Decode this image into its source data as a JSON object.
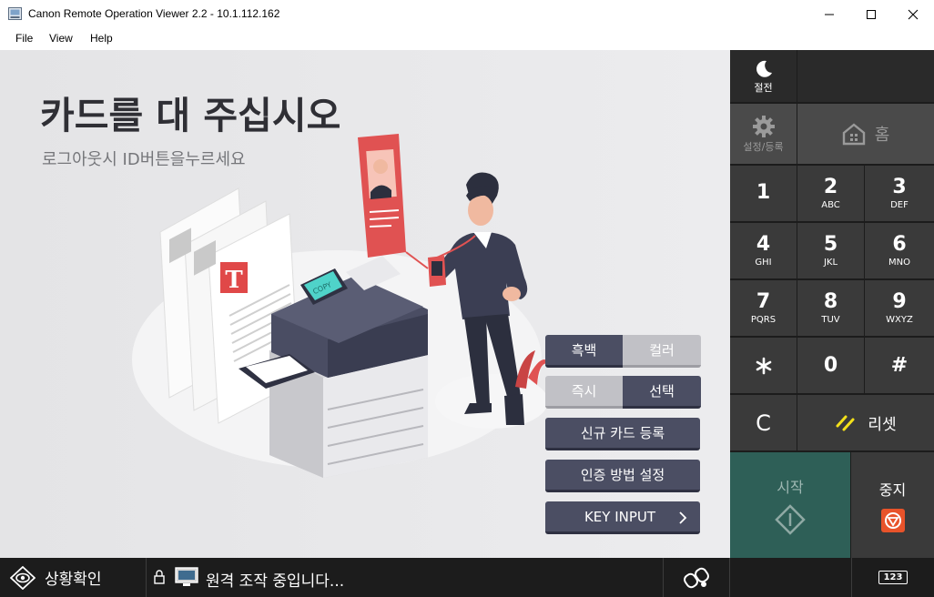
{
  "window": {
    "title": "Canon Remote Operation Viewer 2.2 - 10.1.112.162",
    "menu": [
      "File",
      "View",
      "Help"
    ]
  },
  "screen": {
    "headline": "카드를 대 주십시오",
    "subline": "로그아웃시 ID버튼을누르세요",
    "illustration": {
      "copier_display": "COPY",
      "paper_letter": "T"
    },
    "color_toggle": {
      "left": "흑백",
      "right": "컬러",
      "selected": "left"
    },
    "mode_toggle": {
      "left": "즉시",
      "right": "선택",
      "selected": "right"
    },
    "buttons": {
      "register_card": "신규 카드 등록",
      "auth_settings": "인증 방법 설정",
      "key_input": "KEY INPUT"
    }
  },
  "panel": {
    "sleep_label": "절전",
    "settings_label": "설정/등록",
    "home_label": "홈",
    "keys": [
      {
        "digit": "1",
        "sub": ""
      },
      {
        "digit": "2",
        "sub": "ABC"
      },
      {
        "digit": "3",
        "sub": "DEF"
      },
      {
        "digit": "4",
        "sub": "GHI"
      },
      {
        "digit": "5",
        "sub": "JKL"
      },
      {
        "digit": "6",
        "sub": "MNO"
      },
      {
        "digit": "7",
        "sub": "PQRS"
      },
      {
        "digit": "8",
        "sub": "TUV"
      },
      {
        "digit": "9",
        "sub": "WXYZ"
      },
      {
        "digit": "0",
        "sub": ""
      }
    ],
    "hash_label": "#",
    "clear_label": "C",
    "reset_label": "리셋",
    "start_label": "시작",
    "stop_label": "중지"
  },
  "statusbar": {
    "status_check": "상황확인",
    "remote_message": "원격 조작 중입니다...",
    "counter_label": "123"
  },
  "colors": {
    "screen_bg": "#e8e8ea",
    "button_dark": "#4b4e63",
    "panel_bg": "#1c1c1c",
    "key_bg": "#3a3a3a",
    "start_bg": "#2e5f57",
    "stop_icon": "#e8532a",
    "reset_icon": "#f3e01a",
    "accent_red": "#e05252"
  }
}
